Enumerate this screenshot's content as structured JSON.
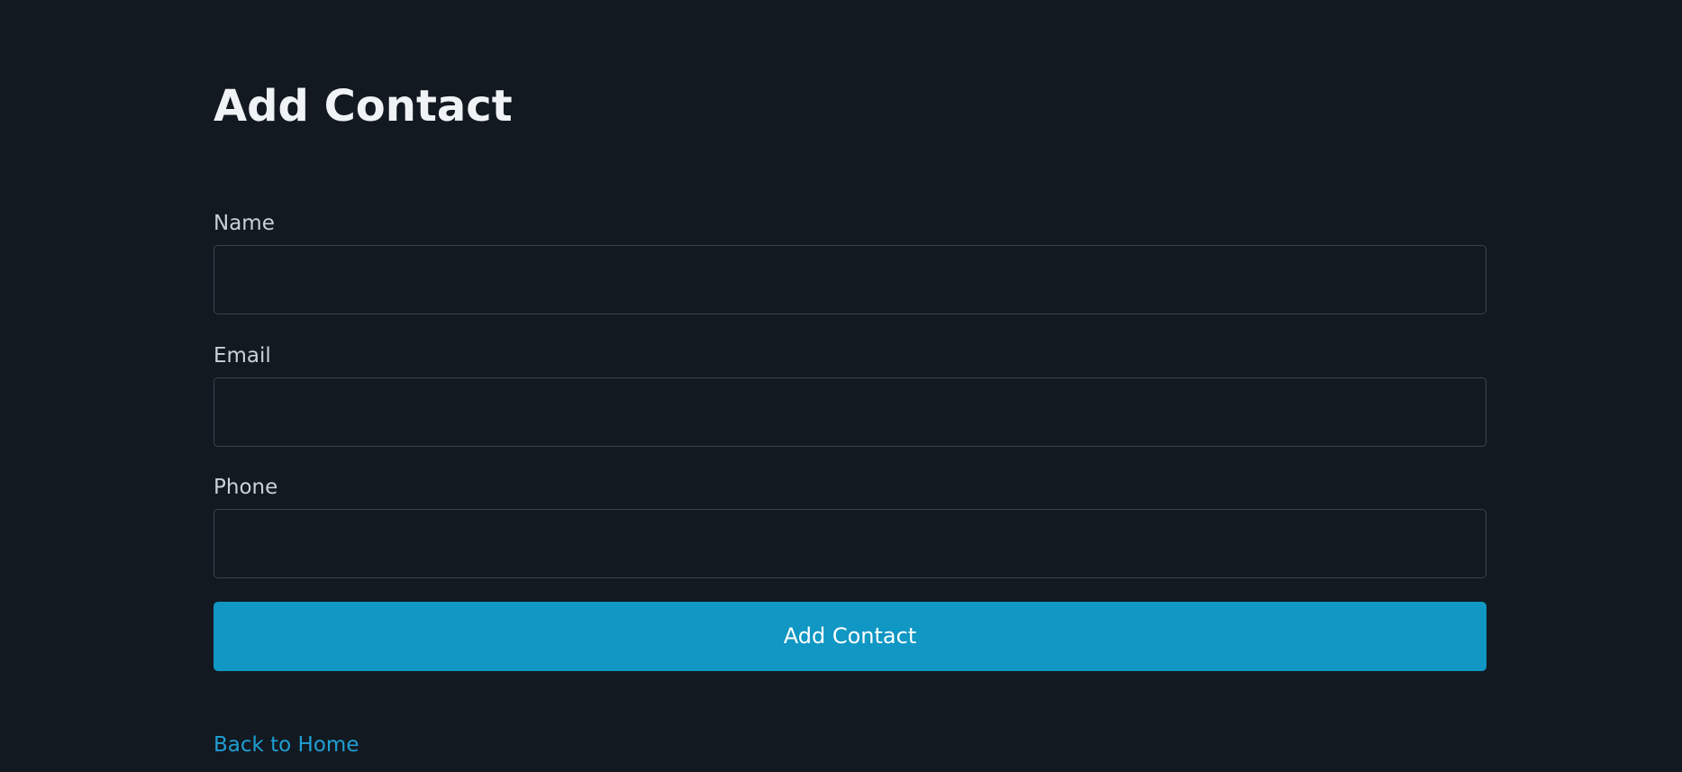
{
  "page": {
    "title": "Add Contact"
  },
  "form": {
    "fields": [
      {
        "label": "Name",
        "value": "",
        "placeholder": ""
      },
      {
        "label": "Email",
        "value": "",
        "placeholder": ""
      },
      {
        "label": "Phone",
        "value": "",
        "placeholder": ""
      }
    ],
    "submit_label": "Add Contact"
  },
  "footer": {
    "back_link_label": "Back to Home"
  },
  "colors": {
    "background": "#131921",
    "accent": "#1097c3",
    "link": "#1f9fd3",
    "input_border": "#3b434c",
    "title_text": "#f0f3f6",
    "label_text": "#c9d1d9"
  }
}
